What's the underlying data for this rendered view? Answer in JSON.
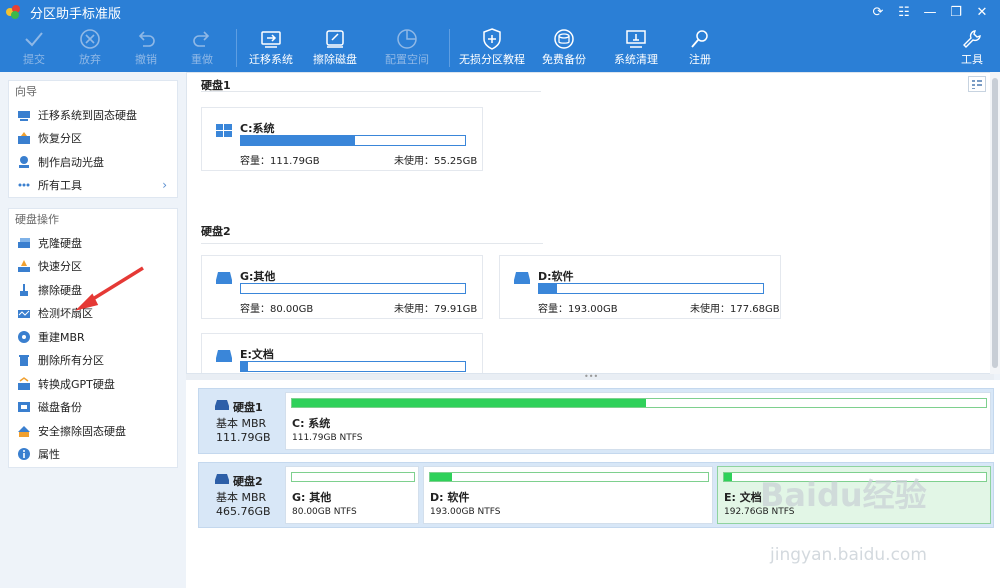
{
  "app": {
    "title": "分区助手标准版"
  },
  "toolbar": {
    "buttons": [
      {
        "label": "提交",
        "icon": "check-icon",
        "enabled": false
      },
      {
        "label": "放弃",
        "icon": "x-circle-icon",
        "enabled": false
      },
      {
        "label": "撤销",
        "icon": "undo-icon",
        "enabled": false
      },
      {
        "label": "重做",
        "icon": "redo-icon",
        "enabled": false
      },
      {
        "label": "迁移系统",
        "icon": "migrate-icon",
        "enabled": true
      },
      {
        "label": "擦除磁盘",
        "icon": "wipe-disk-icon",
        "enabled": true
      },
      {
        "label": "配置空间",
        "icon": "pie-icon",
        "enabled": false
      },
      {
        "label": "无损分区教程",
        "icon": "shield-plus-icon",
        "enabled": true
      },
      {
        "label": "免费备份",
        "icon": "backup-icon",
        "enabled": true
      },
      {
        "label": "系统清理",
        "icon": "clean-icon",
        "enabled": true
      },
      {
        "label": "注册",
        "icon": "key-icon",
        "enabled": true
      },
      {
        "label": "工具",
        "icon": "wrench-icon",
        "enabled": true
      }
    ]
  },
  "sidebar": {
    "wizard": {
      "title": "向导",
      "items": [
        {
          "label": "迁移系统到固态硬盘",
          "icon": "migrate-ssd-icon"
        },
        {
          "label": "恢复分区",
          "icon": "recover-icon"
        },
        {
          "label": "制作启动光盘",
          "icon": "bootdisc-icon"
        },
        {
          "label": "所有工具",
          "icon": "more-icon",
          "chevron": "›"
        }
      ]
    },
    "disk_ops": {
      "title": "硬盘操作",
      "items": [
        {
          "label": "克隆硬盘",
          "icon": "clone-icon"
        },
        {
          "label": "快速分区",
          "icon": "quick-partition-icon"
        },
        {
          "label": "擦除硬盘",
          "icon": "brush-icon"
        },
        {
          "label": "检测坏扇区",
          "icon": "bad-sector-icon"
        },
        {
          "label": "重建MBR",
          "icon": "rebuild-mbr-icon"
        },
        {
          "label": "删除所有分区",
          "icon": "trash-icon"
        },
        {
          "label": "转换成GPT硬盘",
          "icon": "convert-gpt-icon"
        },
        {
          "label": "磁盘备份",
          "icon": "disk-backup-icon"
        },
        {
          "label": "安全擦除固态硬盘",
          "icon": "secure-erase-icon"
        },
        {
          "label": "属性",
          "icon": "info-icon"
        }
      ]
    }
  },
  "main": {
    "disk1": {
      "heading": "硬盘1",
      "partitions": [
        {
          "name": "C:系统",
          "capacity": "容量：111.79GB",
          "free": "未使用：55.25GB",
          "used_fraction": 0.51
        }
      ]
    },
    "disk2": {
      "heading": "硬盘2",
      "partitions": [
        {
          "name": "G:其他",
          "capacity": "容量：80.00GB",
          "free": "未使用：79.91GB",
          "used_fraction": 0.0
        },
        {
          "name": "D:软件",
          "capacity": "容量：193.00GB",
          "free": "未使用：177.68GB",
          "used_fraction": 0.08
        },
        {
          "name": "E:文档",
          "used_fraction": 0.03
        }
      ]
    }
  },
  "diskmap": [
    {
      "name": "硬盘1",
      "type": "基本 MBR",
      "size": "111.79GB",
      "partitions": [
        {
          "name": "C: 系统",
          "fs": "111.79GB NTFS",
          "used_fraction": 0.51,
          "selected": false
        }
      ]
    },
    {
      "name": "硬盘2",
      "type": "基本 MBR",
      "size": "465.76GB",
      "partitions": [
        {
          "name": "G: 其他",
          "fs": "80.00GB NTFS",
          "used_fraction": 0.0,
          "selected": false
        },
        {
          "name": "D: 软件",
          "fs": "193.00GB NTFS",
          "used_fraction": 0.08,
          "selected": false
        },
        {
          "name": "E: 文档",
          "fs": "192.76GB NTFS",
          "used_fraction": 0.03,
          "selected": true
        }
      ]
    }
  ],
  "watermark": {
    "text": "Baidu经验",
    "sub": "jingyan.baidu.com"
  },
  "colors": {
    "titlebar": "#2b7fd6",
    "accent": "#3a86d9",
    "partition_fill": "#2fd15a",
    "annotation_arrow": "#e53935"
  }
}
